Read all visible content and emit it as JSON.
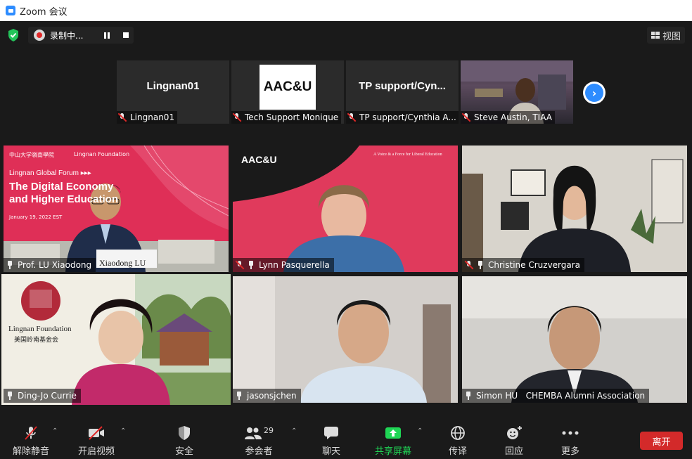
{
  "window": {
    "title": "Zoom 会议"
  },
  "topbar": {
    "recording_label": "录制中...",
    "view_label": "视图"
  },
  "strip": [
    {
      "center_text": "Lingnan01",
      "name": "Lingnan01",
      "muted": true
    },
    {
      "center_text": "AAC&U",
      "name": "Tech Support Monique",
      "muted": true
    },
    {
      "center_text": "TP support/Cyn...",
      "name": "TP support/Cynthia A...",
      "muted": true
    },
    {
      "center_text": "",
      "name": "Steve Austin, TIAA",
      "muted": true
    }
  ],
  "gallery": [
    {
      "name": "Prof. LU Xiaodong",
      "muted": false,
      "slide": {
        "header_left": "中山大学嶺南學院",
        "header_right": "Lingnan Foundation",
        "forum": "Lingnan Global Forum ▸▸▸",
        "title_line1": "The Digital Economy",
        "title_line2": "and Higher Education",
        "date": "January 19, 2022 EST",
        "nameplate": "Xiaodong LU"
      }
    },
    {
      "name": "Lynn Pasquerella",
      "muted": true,
      "bg_logo": "AAC&U",
      "bg_tagline": "A Voice & a Force for Liberal Education"
    },
    {
      "name": "Christine Cruzvergara",
      "muted": true
    },
    {
      "name": "Ding-Jo Currie",
      "muted": false,
      "active": true,
      "bg_logo_line1": "Lingnan Foundation",
      "bg_logo_line2": "美国岭南基金会"
    },
    {
      "name": "jasonsjchen",
      "muted": false
    },
    {
      "name": "Simon HU   CHEMBA Alumni Association",
      "muted": false
    }
  ],
  "toolbar": {
    "unmute": "解除静音",
    "start_video": "开启视频",
    "security": "安全",
    "participants": "参会者",
    "participants_count": "29",
    "chat": "聊天",
    "share": "共享屏幕",
    "interpretation": "传译",
    "reactions": "回应",
    "more": "更多",
    "leave": "离开"
  },
  "colors": {
    "accent": "#2d8cff",
    "share_green": "#1fd655",
    "leave_red": "#d32a2a",
    "active_speaker": "#f5f08c"
  }
}
